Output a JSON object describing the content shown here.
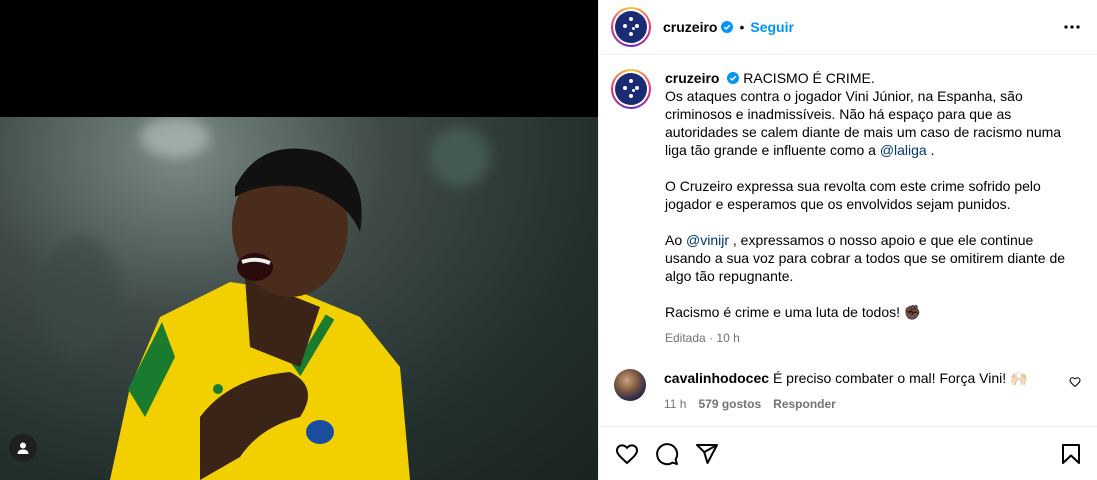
{
  "post": {
    "username": "cruzeiro",
    "follow_label": "Seguir",
    "separator": "•"
  },
  "caption": {
    "username": "cruzeiro",
    "title": "RACISMO É CRIME.",
    "para1": "Os ataques contra o jogador Vini Júnior, na Espanha, são criminosos e inadmissíveis. Não há espaço para que as autoridades se calem diante de mais um caso de racismo numa liga tão grande e influente como a ",
    "mention1": "@laliga",
    "para1_end": " .",
    "para2": "O Cruzeiro expressa sua revolta com este crime sofrido pelo jogador e esperamos que os envolvidos sejam punidos.",
    "para3_start": "Ao ",
    "mention2": "@vinijr",
    "para3_end": " , expressamos o nosso apoio e que ele continue usando a sua voz para cobrar a todos que se omitirem diante de algo tão repugnante.",
    "para4": "Racismo é crime e uma luta de todos! ✊🏿",
    "edited_label": "Editada",
    "time": "10 h"
  },
  "comment": {
    "username": "cavalinhodocec",
    "text": "É preciso combater o mal! Força Vini! 🙌🏻",
    "time": "11 h",
    "likes": "579 gostos",
    "reply_label": "Responder"
  },
  "icons": {
    "more": "more-options-icon",
    "like": "heart-icon",
    "comment": "comment-icon",
    "share": "share-icon",
    "save": "bookmark-icon",
    "user_tag": "user-tag-icon",
    "verified": "verified-badge-icon"
  },
  "colors": {
    "link": "#0095f6",
    "mention": "#00376b",
    "muted": "#737373",
    "avatar_bg": "#1a2a73"
  }
}
